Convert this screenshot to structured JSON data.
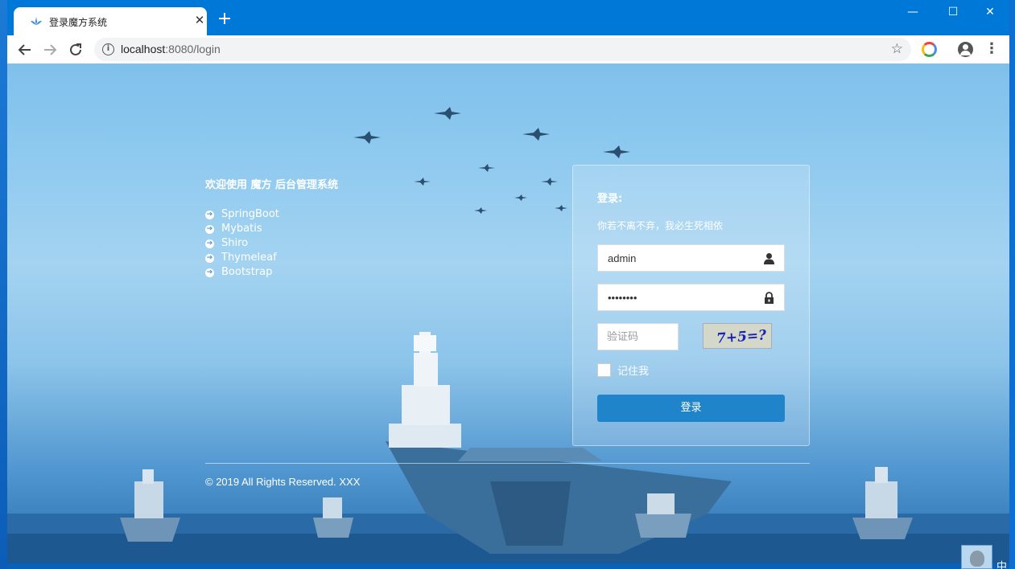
{
  "browser": {
    "tab_title": "登录魔方系统",
    "tab_close": "✕",
    "new_tab": "+",
    "url_host": "localhost",
    "url_path": ":8080/login",
    "window_min": "—",
    "window_max": "☐",
    "window_close": "✕"
  },
  "icons": {
    "back": "back-arrow-icon",
    "forward": "forward-arrow-icon",
    "reload": "reload-icon",
    "info": "info-icon",
    "star": "star-icon",
    "extension": "chrome-extension-icon",
    "account": "account-icon",
    "menu": "kebab-menu-icon"
  },
  "intro": {
    "title": "欢迎使用 魔方 后台管理系统",
    "features": [
      "SpringBoot",
      "Mybatis",
      "Shiro",
      "Thymeleaf",
      "Bootstrap"
    ]
  },
  "login": {
    "heading": "登录:",
    "subtitle": "你若不离不弃，我必生死相依",
    "username_value": "admin",
    "password_value": "••••••••",
    "captcha_placeholder": "验证码",
    "captcha_text": "7+5=?",
    "remember_label": "记住我",
    "submit_label": "登录"
  },
  "footer": {
    "copyright": "© 2019 All Rights Reserved. XXX"
  },
  "ime": {
    "label": "中"
  },
  "colors": {
    "titlebar": "#0078d7",
    "login_button": "#1f84c9"
  }
}
